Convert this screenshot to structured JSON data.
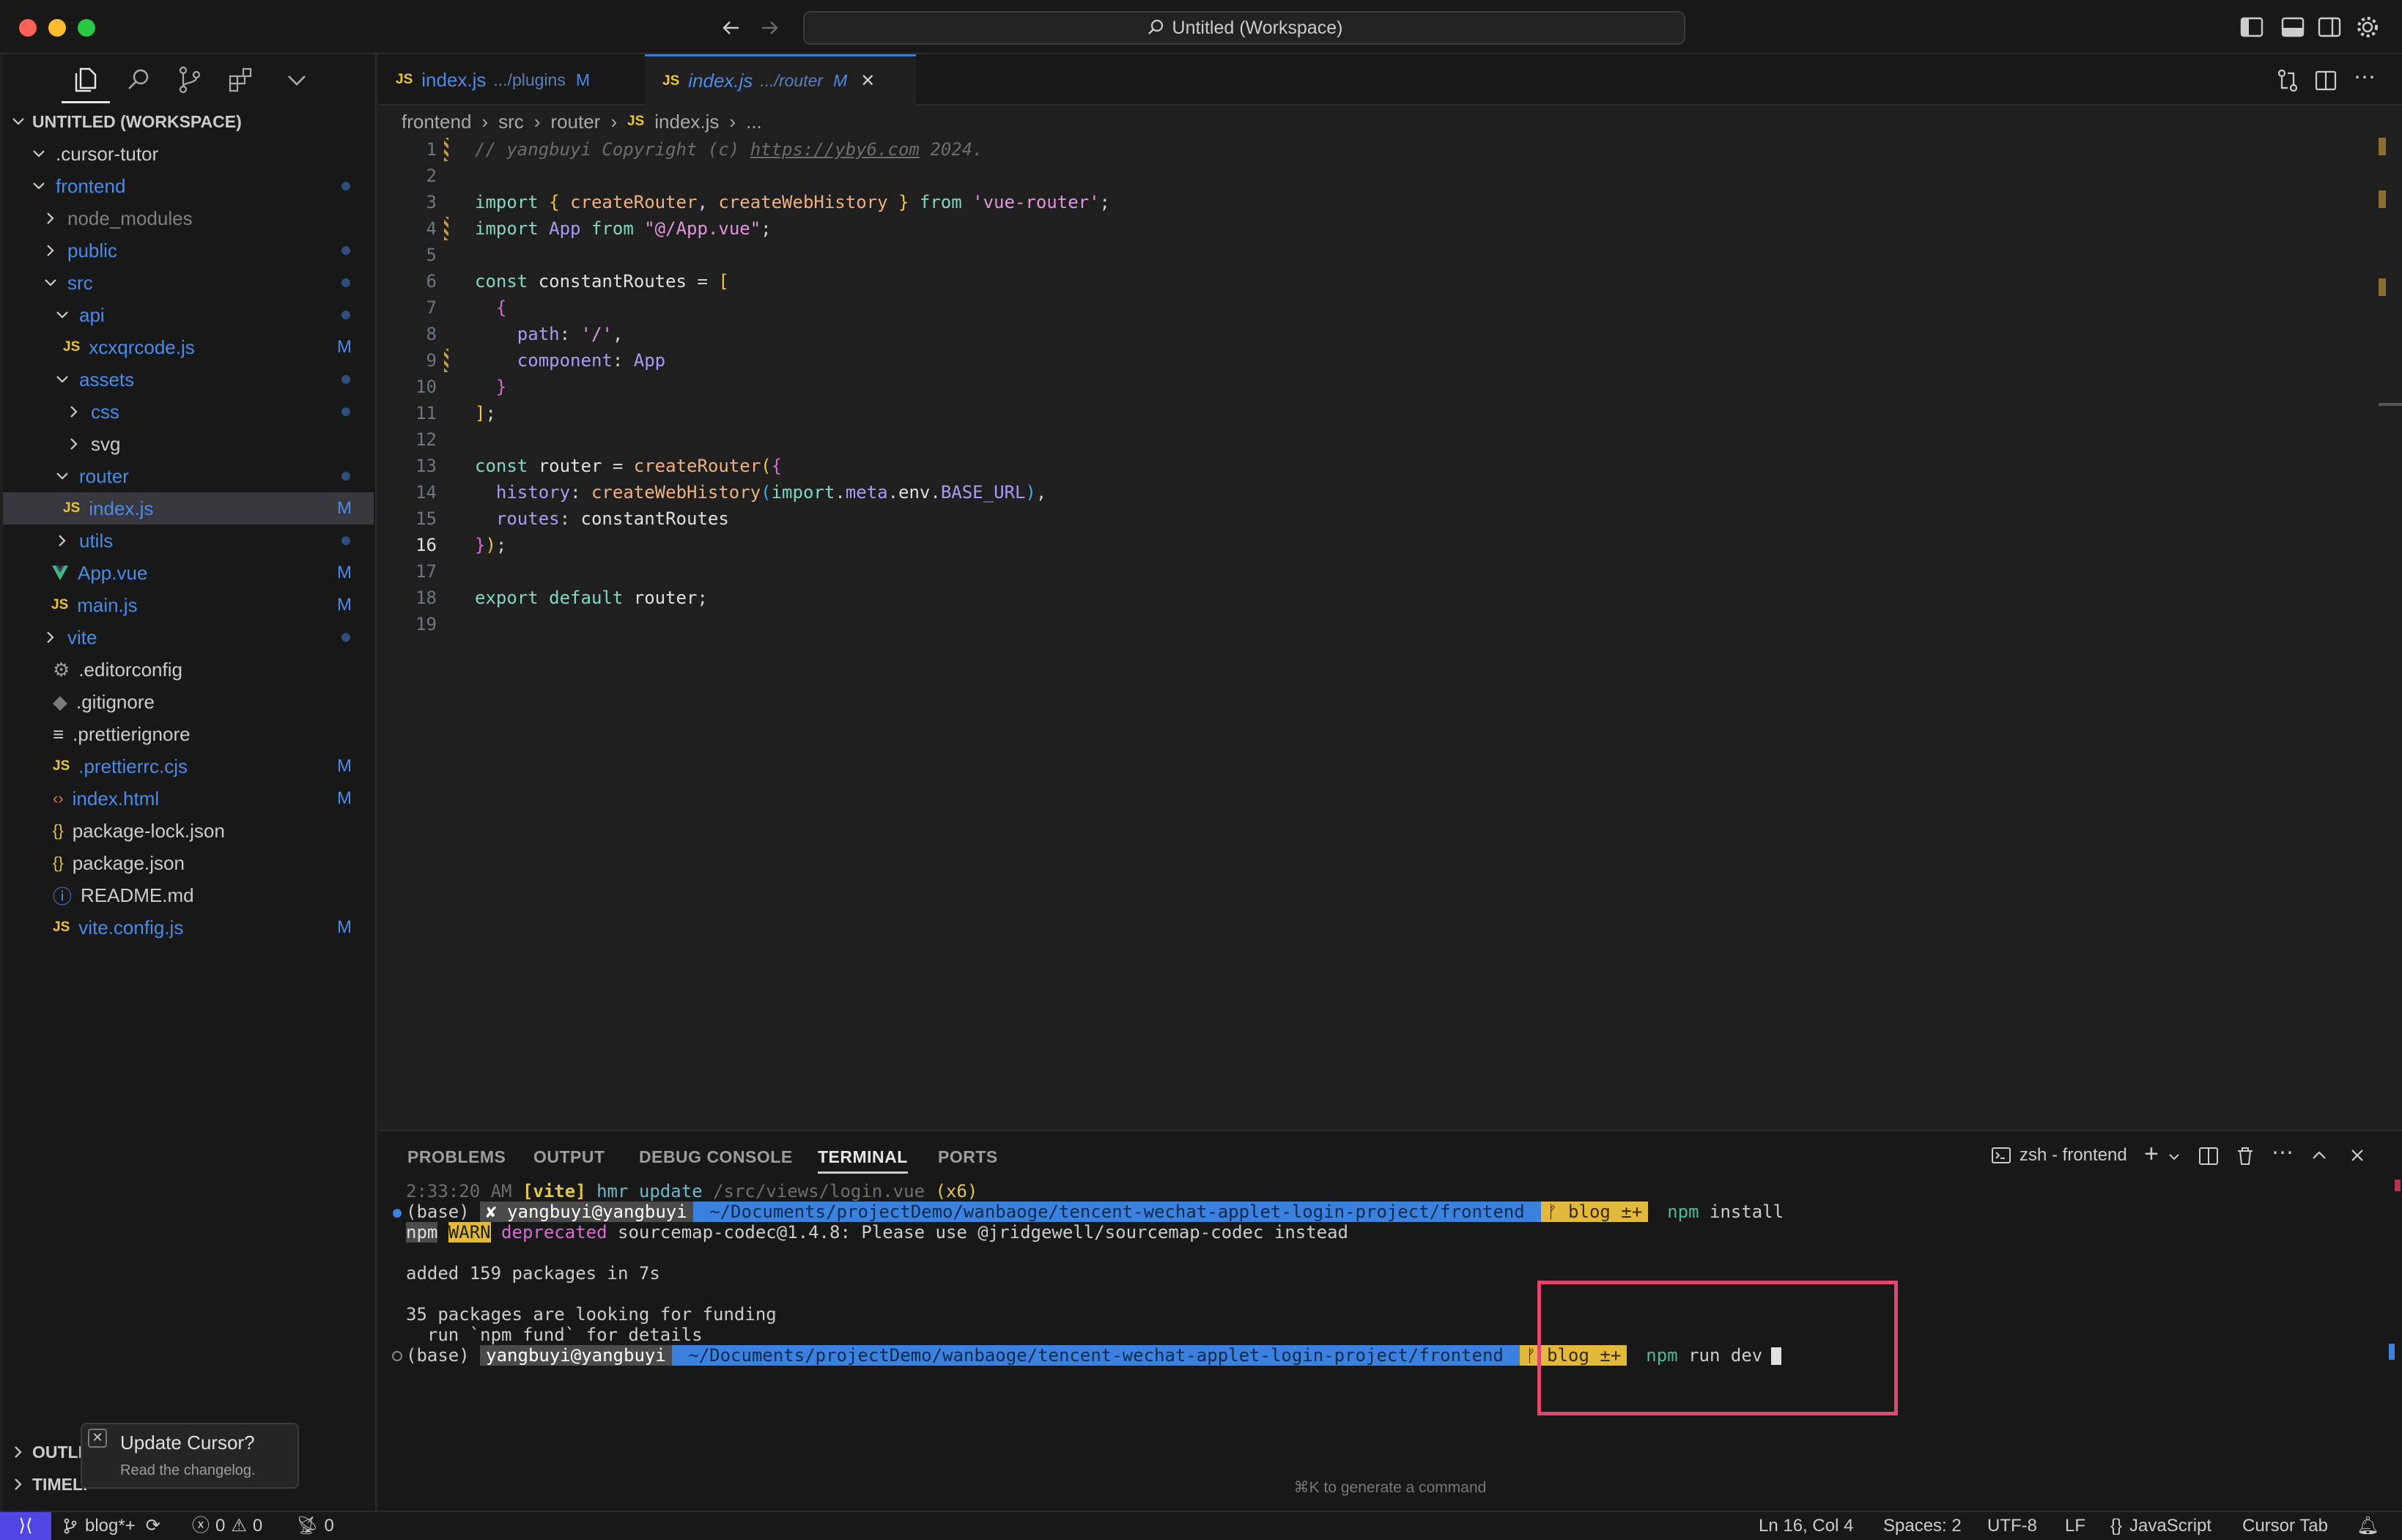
{
  "titlebar": {
    "search_text": "Untitled (Workspace)"
  },
  "sidebar": {
    "workspace_title": "UNTITLED (WORKSPACE)",
    "tree": [
      {
        "label": "cursor-tutor",
        "prefix": ".",
        "depth": 1,
        "kind": "folder-open",
        "color": "#cccccc",
        "badge": "",
        "dot": false
      },
      {
        "label": "frontend",
        "depth": 1,
        "kind": "folder-open",
        "color": "#4b8be8",
        "badge": "",
        "dot": true
      },
      {
        "label": "node_modules",
        "depth": 2,
        "kind": "folder",
        "color": "#7f7f7f",
        "badge": "",
        "dot": false
      },
      {
        "label": "public",
        "depth": 2,
        "kind": "folder",
        "color": "#4b8be8",
        "badge": "",
        "dot": true
      },
      {
        "label": "src",
        "depth": 2,
        "kind": "folder-open",
        "color": "#4b8be8",
        "badge": "",
        "dot": true
      },
      {
        "label": "api",
        "depth": 3,
        "kind": "folder-open",
        "color": "#4b8be8",
        "badge": "",
        "dot": true
      },
      {
        "label": "xcxqrcode.js",
        "depth": 4,
        "kind": "js",
        "color": "#4b8be8",
        "badge": "M",
        "dot": false
      },
      {
        "label": "assets",
        "depth": 3,
        "kind": "folder-open",
        "color": "#4b8be8",
        "badge": "",
        "dot": true
      },
      {
        "label": "css",
        "depth": 4,
        "kind": "folder",
        "color": "#4b8be8",
        "badge": "",
        "dot": true
      },
      {
        "label": "svg",
        "depth": 4,
        "kind": "folder",
        "color": "#cccccc",
        "badge": "",
        "dot": false
      },
      {
        "label": "router",
        "depth": 3,
        "kind": "folder-open",
        "color": "#4b8be8",
        "badge": "",
        "dot": true
      },
      {
        "label": "index.js",
        "depth": 4,
        "kind": "js",
        "color": "#4b8be8",
        "badge": "M",
        "dot": false,
        "selected": true
      },
      {
        "label": "utils",
        "depth": 3,
        "kind": "folder",
        "color": "#4b8be8",
        "badge": "",
        "dot": true
      },
      {
        "label": "App.vue",
        "depth": 3,
        "kind": "vue",
        "color": "#4b8be8",
        "badge": "M",
        "dot": false
      },
      {
        "label": "main.js",
        "depth": 3,
        "kind": "js",
        "color": "#4b8be8",
        "badge": "M",
        "dot": false
      },
      {
        "label": "vite",
        "depth": 2,
        "kind": "folder",
        "color": "#4b8be8",
        "badge": "",
        "dot": true
      },
      {
        "label": ".editorconfig",
        "depth": 2,
        "kind": "gear",
        "color": "#cccccc",
        "badge": "",
        "dot": false
      },
      {
        "label": ".gitignore",
        "depth": 2,
        "kind": "git",
        "color": "#cccccc",
        "badge": "",
        "dot": false
      },
      {
        "label": ".prettierignore",
        "depth": 2,
        "kind": "lines",
        "color": "#cccccc",
        "badge": "",
        "dot": false
      },
      {
        "label": ".prettierrc.cjs",
        "depth": 2,
        "kind": "js",
        "color": "#4b8be8",
        "badge": "M",
        "dot": false
      },
      {
        "label": "index.html",
        "depth": 2,
        "kind": "html",
        "color": "#4b8be8",
        "badge": "M",
        "dot": false
      },
      {
        "label": "package-lock.json",
        "depth": 2,
        "kind": "json",
        "color": "#cccccc",
        "badge": "",
        "dot": false
      },
      {
        "label": "package.json",
        "depth": 2,
        "kind": "json",
        "color": "#cccccc",
        "badge": "",
        "dot": false
      },
      {
        "label": "README.md",
        "depth": 2,
        "kind": "info",
        "color": "#cccccc",
        "badge": "",
        "dot": false
      },
      {
        "label": "vite.config.js",
        "depth": 2,
        "kind": "js",
        "color": "#4b8be8",
        "badge": "M",
        "dot": false
      }
    ],
    "outline_label": "OUTLI",
    "timeline_label": "TIMELI"
  },
  "file_icon_labels": {
    "js": "JS"
  },
  "tabs": [
    {
      "name": "index.js",
      "path": ".../plugins",
      "badge": "M",
      "active": false
    },
    {
      "name": "index.js",
      "path": ".../router",
      "badge": "M",
      "active": true,
      "close": "✕"
    }
  ],
  "breadcrumb": [
    "frontend",
    "src",
    "router",
    "index.js",
    "..."
  ],
  "code": {
    "lines": [
      {
        "n": "1",
        "mod": true,
        "tokens": [
          [
            "cm",
            "// yangbuyi Copyright (c) "
          ],
          [
            "cmu",
            "https://yby6.com"
          ],
          [
            "cm",
            " 2024."
          ]
        ]
      },
      {
        "n": "2",
        "tokens": []
      },
      {
        "n": "3",
        "tokens": [
          [
            "kw",
            "import "
          ],
          [
            "br1",
            "{ "
          ],
          [
            "fn",
            "createRouter"
          ],
          [
            "punc",
            ", "
          ],
          [
            "fn",
            "createWebHistory"
          ],
          [
            "br1",
            " }"
          ],
          [
            "kw",
            " from "
          ],
          [
            "str",
            "'vue-router'"
          ],
          [
            "punc",
            ";"
          ]
        ]
      },
      {
        "n": "4",
        "mod": true,
        "tokens": [
          [
            "kw",
            "import "
          ],
          [
            "prop",
            "App"
          ],
          [
            "kw",
            " from "
          ],
          [
            "str",
            "\"@/App.vue\""
          ],
          [
            "punc",
            ";"
          ]
        ]
      },
      {
        "n": "5",
        "tokens": []
      },
      {
        "n": "6",
        "tokens": [
          [
            "kw",
            "const "
          ],
          [
            "id",
            "constantRoutes"
          ],
          [
            "punc",
            " = "
          ],
          [
            "br1",
            "["
          ]
        ]
      },
      {
        "n": "7",
        "tokens": [
          [
            "id",
            "  "
          ],
          [
            "br2",
            "{"
          ]
        ]
      },
      {
        "n": "8",
        "tokens": [
          [
            "id",
            "    "
          ],
          [
            "prop",
            "path"
          ],
          [
            "punc",
            ": "
          ],
          [
            "str",
            "'/'"
          ],
          [
            "punc",
            ","
          ]
        ]
      },
      {
        "n": "9",
        "mod": true,
        "tokens": [
          [
            "id",
            "    "
          ],
          [
            "prop",
            "component"
          ],
          [
            "punc",
            ": "
          ],
          [
            "prop",
            "App"
          ]
        ]
      },
      {
        "n": "10",
        "tokens": [
          [
            "id",
            "  "
          ],
          [
            "br2",
            "}"
          ]
        ]
      },
      {
        "n": "11",
        "tokens": [
          [
            "br1",
            "]"
          ],
          [
            "punc",
            ";"
          ]
        ]
      },
      {
        "n": "12",
        "tokens": []
      },
      {
        "n": "13",
        "tokens": [
          [
            "kw",
            "const "
          ],
          [
            "id",
            "router"
          ],
          [
            "punc",
            " = "
          ],
          [
            "fn",
            "createRouter"
          ],
          [
            "br1",
            "("
          ],
          [
            "br2",
            "{"
          ]
        ]
      },
      {
        "n": "14",
        "tokens": [
          [
            "id",
            "  "
          ],
          [
            "prop",
            "history"
          ],
          [
            "punc",
            ": "
          ],
          [
            "fn",
            "createWebHistory"
          ],
          [
            "br3",
            "("
          ],
          [
            "kw",
            "import"
          ],
          [
            "punc",
            "."
          ],
          [
            "prop",
            "meta"
          ],
          [
            "punc",
            "."
          ],
          [
            "id",
            "env"
          ],
          [
            "punc",
            "."
          ],
          [
            "prop",
            "BASE_URL"
          ],
          [
            "br3",
            ")"
          ],
          [
            "punc",
            ","
          ]
        ]
      },
      {
        "n": "15",
        "tokens": [
          [
            "id",
            "  "
          ],
          [
            "prop",
            "routes"
          ],
          [
            "punc",
            ": "
          ],
          [
            "id",
            "constantRoutes"
          ]
        ]
      },
      {
        "n": "16",
        "tokens": [
          [
            "br2",
            "}"
          ],
          [
            "br1",
            ")"
          ],
          [
            "punc",
            ";"
          ]
        ]
      },
      {
        "n": "17",
        "tokens": []
      },
      {
        "n": "18",
        "tokens": [
          [
            "kw",
            "export default "
          ],
          [
            "id",
            "router"
          ],
          [
            "punc",
            ";"
          ]
        ]
      },
      {
        "n": "19",
        "tokens": []
      }
    ]
  },
  "panel": {
    "tabs": [
      "PROBLEMS",
      "OUTPUT",
      "DEBUG CONSOLE",
      "TERMINAL",
      "PORTS"
    ],
    "active_tab": "TERMINAL",
    "terminal_name": "zsh - frontend",
    "lines": {
      "l1_time": "2:33:20 AM ",
      "l1_vite": "[vite]",
      "l1_rest": " hmr update ",
      "l1_path": "/src/views/login.vue",
      "l1_count": " (x6)",
      "p1_base": "(base) ",
      "p1_user": "✘ yangbuyi@yangbuyi",
      "p1_path": " ~/Documents/projectDemo/wanbaoge/tencent-wechat-applet-login-project/frontend ",
      "p1_branch": "ᚠ blog ±+",
      "p1_cmd_npm": "npm",
      "p1_cmd_rest": " install",
      "warn_npm": "npm",
      "warn_label": "WARN",
      "warn_dep": " deprecated",
      "warn_rest": " sourcemap-codec@1.4.8: Please use @jridgewell/sourcemap-codec instead",
      "added": "added 159 packages in 7s",
      "funding1": "35 packages are looking for funding",
      "funding2": "  run `npm fund` for details",
      "p2_base": "(base) ",
      "p2_user": "yangbuyi@yangbuyi",
      "p2_path": " ~/Documents/projectDemo/wanbaoge/tencent-wechat-applet-login-project/frontend ",
      "p2_branch": "ᚠ blog ±+",
      "p2_cmd_npm": "npm",
      "p2_cmd_rest": " run dev"
    },
    "hint": "⌘K to generate a command"
  },
  "notification": {
    "title": "Update Cursor?",
    "subtitle": "Read the changelog."
  },
  "statusbar": {
    "remote": "⟩⟨",
    "branch": "blog*+",
    "errors": "0",
    "warnings": "0",
    "ports": "0",
    "position": "Ln 16, Col 4",
    "spaces": "Spaces: 2",
    "encoding": "UTF-8",
    "eol": "LF",
    "language": "JavaScript",
    "cursor_tab": "Cursor Tab"
  },
  "colors": {
    "accent": "#3a7bd5",
    "modified": "#4b8be8",
    "highlight_box": "#e2456d"
  }
}
